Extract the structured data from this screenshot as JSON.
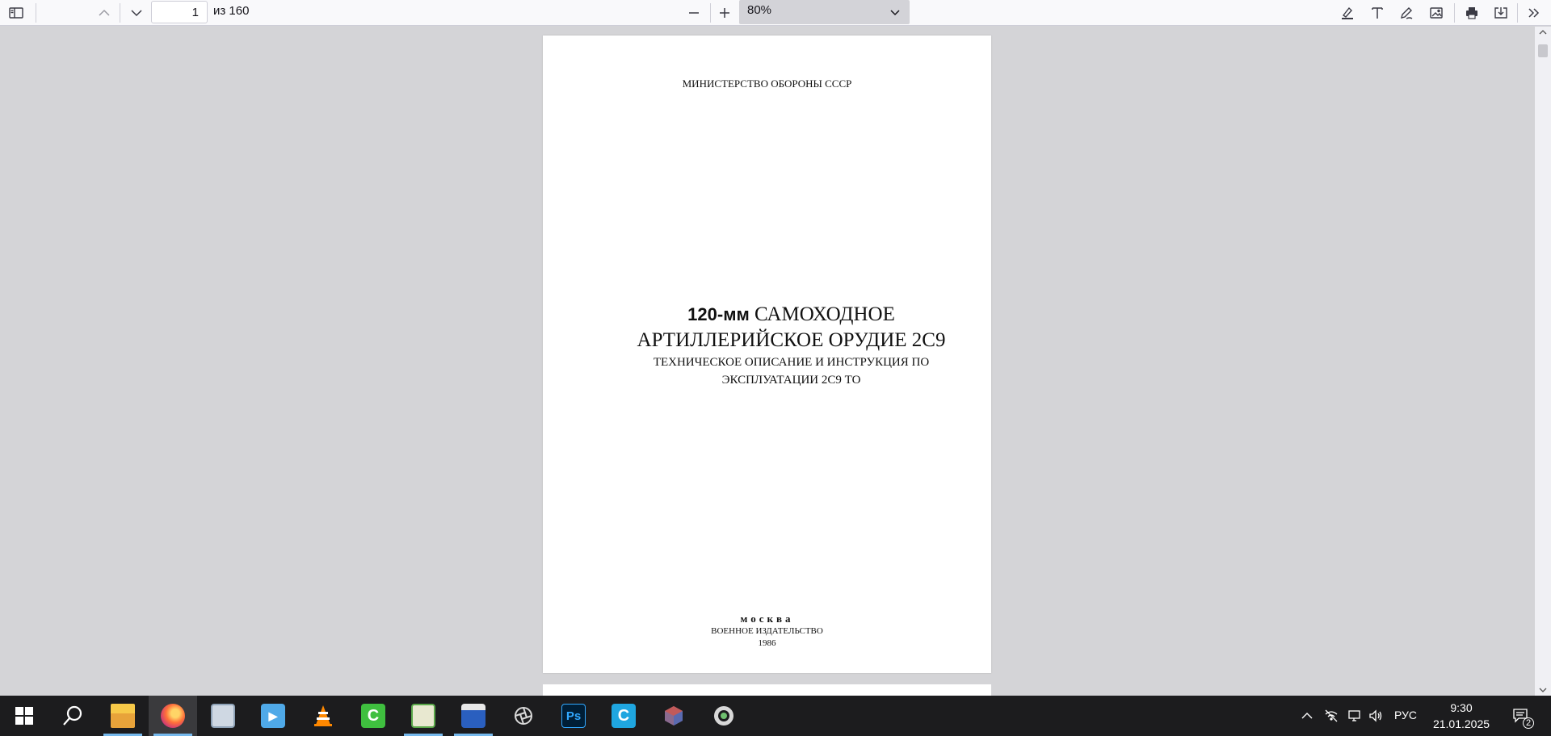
{
  "toolbar": {
    "sidebar_toggle_icon": "sidebar-icon",
    "prev_page_icon": "chevron-up-icon",
    "next_page_icon": "chevron-down-icon",
    "page_number": "1",
    "page_of": "из 160",
    "zoom_out_icon": "minus-icon",
    "zoom_in_icon": "plus-icon",
    "zoom_value": "80%",
    "tools": [
      "highlight-icon",
      "text-icon",
      "draw-icon",
      "image-icon",
      "print-icon",
      "save-icon",
      "more-tools-icon"
    ]
  },
  "document": {
    "ministry": "МИНИСТЕРСТВО ОБОРОНЫ СССР",
    "title_prefix": "120-мм",
    "title_line1_rest": " САМОХОДНОЕ",
    "title_line2": "АРТИЛЛЕРИЙСКОЕ ОРУДИЕ 2С9",
    "subtitle_line1": "ТЕХНИЧЕСКОЕ ОПИСАНИЕ И ИНСТРУКЦИЯ ПО",
    "subtitle_line2": "ЭКСПЛУАТАЦИИ 2С9 ТО",
    "city": "москва",
    "publisher": "ВОЕННОЕ ИЗДАТЕЛЬСТВО",
    "year": "1986"
  },
  "taskbar": {
    "apps": [
      "windows-start",
      "search",
      "file-explorer",
      "firefox",
      "notes-app",
      "media-player",
      "vlc",
      "camtasia",
      "paint-app",
      "floppy-app",
      "aperture-app",
      "photoshop",
      "cinema-app",
      "cube-app",
      "eye-app"
    ],
    "active_app": "firefox",
    "photoshop_label": "Ps",
    "lang": "РУС",
    "time": "9:30",
    "date": "21.01.2025",
    "notifications": "2"
  },
  "colors": {
    "toolbar_bg": "#f9f9fb",
    "viewer_bg": "#d4d4d7",
    "taskbar_bg": "#1c1c1e",
    "zoom_bg": "#d3d3d8"
  }
}
